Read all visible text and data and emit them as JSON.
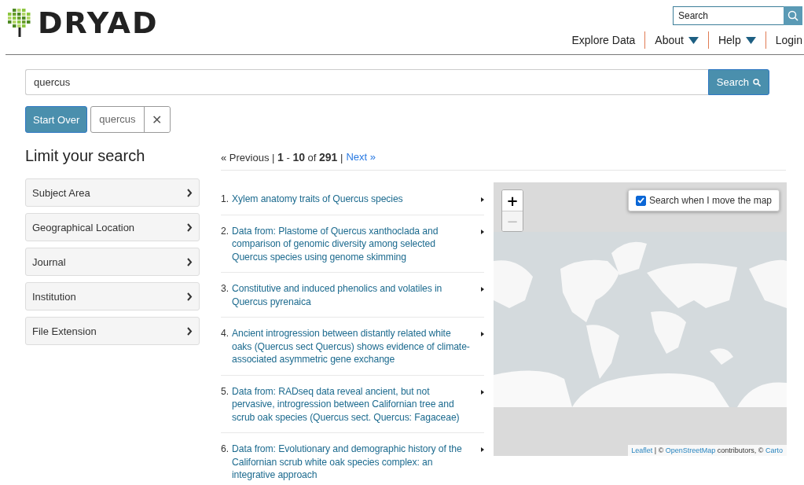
{
  "header": {
    "logo": "DRYAD",
    "search": {
      "placeholder": "Search"
    },
    "nav": [
      {
        "label": "Explore Data",
        "dropdown": false
      },
      {
        "label": "About",
        "dropdown": true
      },
      {
        "label": "Help",
        "dropdown": true
      },
      {
        "label": "Login",
        "dropdown": false
      }
    ]
  },
  "query": {
    "value": "quercus",
    "button": "Search"
  },
  "constraints": {
    "start_over": "Start Over",
    "filters": [
      {
        "label": "quercus",
        "remove": "✕"
      }
    ]
  },
  "sidebar": {
    "title": "Limit your search",
    "facets": [
      {
        "label": "Subject Area",
        "expanded": false
      },
      {
        "label": "Geographical Location",
        "expanded": false
      },
      {
        "label": "Journal",
        "expanded": false
      },
      {
        "label": "Institution",
        "expanded": false
      },
      {
        "label": "File Extension",
        "expanded": false
      }
    ]
  },
  "pagination": {
    "summary": "« Previous | **1** - **10** of **291** |",
    "next": "Next »"
  },
  "results": [
    {
      "number": "1.",
      "title": "Xylem anatomy traits of Quercus species"
    },
    {
      "number": "2.",
      "title": "Data from: Plastome of Quercus xanthoclada and comparison of genomic diversity among selected Quercus species using genome skimming"
    },
    {
      "number": "3.",
      "title": "Constitutive and induced phenolics and volatiles in Quercus pyrenaica"
    },
    {
      "number": "4.",
      "title": "Ancient introgression between distantly related white oaks (Quercus sect Quercus) shows evidence of climate-associated asymmetric gene exchange"
    },
    {
      "number": "5.",
      "title": "Data from: RADseq data reveal ancient, but not pervasive, introgression between Californian tree and scrub oak species (Quercus sect. Quercus: Fagaceae)"
    },
    {
      "number": "6.",
      "title": "Data from: Evolutionary and demographic history of the Californian scrub white oak species complex: an integrative approach"
    }
  ],
  "map": {
    "kind": "picture",
    "zoom": [
      {
        "label": "+",
        "disabled": false
      },
      {
        "label": "−",
        "disabled": true
      }
    ],
    "search_on_move": {
      "label": "Search when I move the map",
      "checked": true
    },
    "attribution": [
      {
        "text": "Leaflet",
        "link": true
      },
      {
        "text": " | © ",
        "link": false
      },
      {
        "text": "OpenStreetMap",
        "link": true
      },
      {
        "text": " contributors, © ",
        "link": false
      },
      {
        "text": "Carto",
        "link": true
      }
    ]
  }
}
